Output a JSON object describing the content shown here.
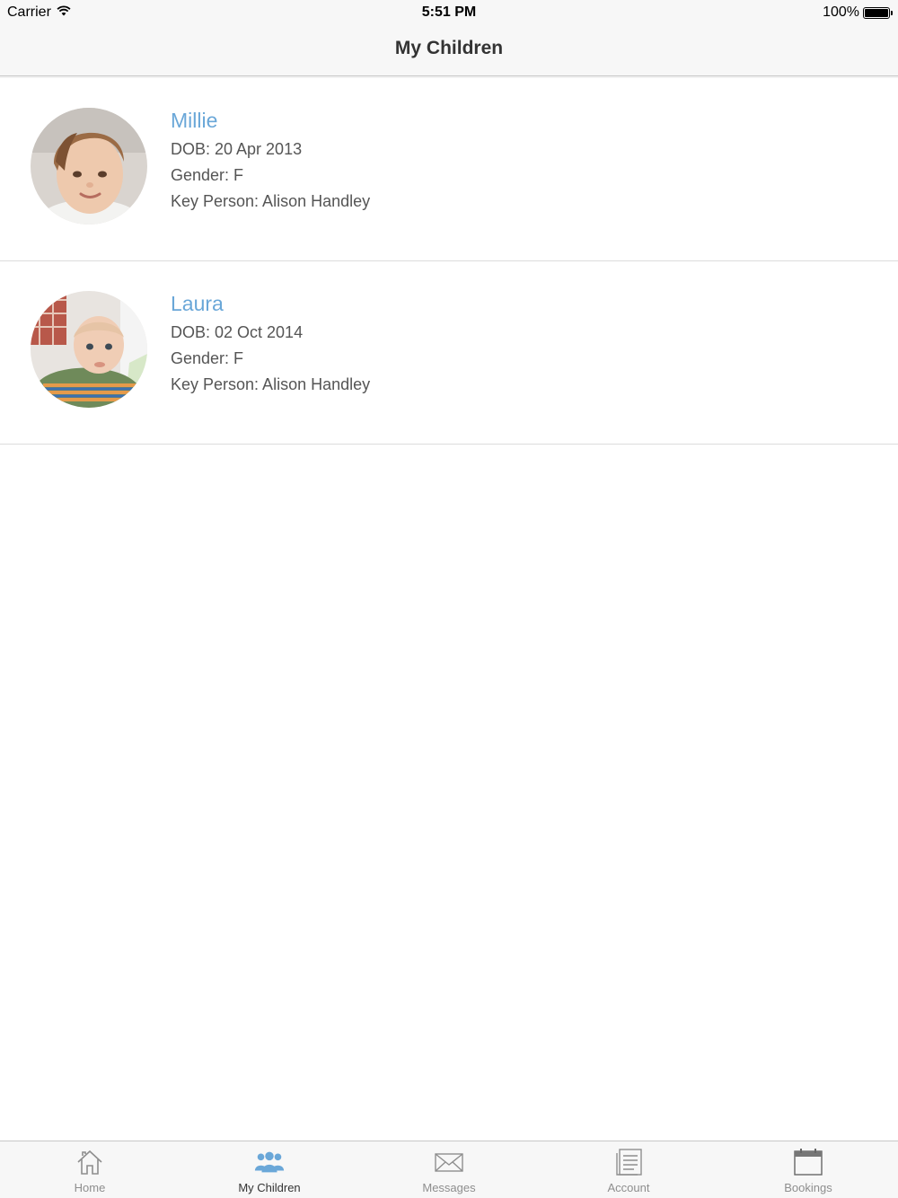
{
  "status_bar": {
    "carrier": "Carrier",
    "time": "5:51 PM",
    "battery": "100%",
    "battery_level": 1.0
  },
  "nav": {
    "title": "My Children"
  },
  "children": [
    {
      "name": "Millie",
      "dob": "DOB: 20 Apr 2013",
      "gender": "Gender: F",
      "key_person": "Key Person: Alison Handley"
    },
    {
      "name": "Laura",
      "dob": "DOB: 02 Oct 2014",
      "gender": "Gender: F",
      "key_person": "Key Person: Alison Handley"
    }
  ],
  "tabs": [
    {
      "label": "Home",
      "icon": "home-icon",
      "active": false
    },
    {
      "label": "My Children",
      "icon": "people-icon",
      "active": true
    },
    {
      "label": "Messages",
      "icon": "envelope-icon",
      "active": false
    },
    {
      "label": "Account",
      "icon": "document-icon",
      "active": false
    },
    {
      "label": "Bookings",
      "icon": "calendar-icon",
      "active": false
    }
  ],
  "colors": {
    "accent": "#6aa7d8",
    "tab_inactive": "#8e8e8e",
    "bar_bg": "#f7f7f7"
  }
}
